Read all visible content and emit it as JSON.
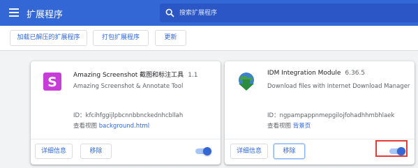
{
  "header": {
    "title": "扩展程序",
    "search_placeholder": "搜索扩展程序",
    "menu_icon": "hamburger-menu-icon",
    "search_icon": "search-icon"
  },
  "toolbar": {
    "load_unpacked": "加载已解压的扩展程序",
    "pack_extension": "打包扩展程序",
    "update": "更新"
  },
  "extensions": [
    {
      "name": "Amazing Screenshot 截图和标注工具",
      "version": "1.1",
      "description": "Amazing Screenshot & Annotate Tool",
      "id_label": "ID：kfcihfggijlpbcnnbbnckednhcbllah",
      "views_label": "查看视图",
      "views_link": "background.html",
      "details_button": "详细信息",
      "remove_button": "移除",
      "enabled": true,
      "icon": "amazing-screenshot-logo-icon",
      "icon_color": "#c83dd8"
    },
    {
      "name": "IDM Integration Module",
      "version": "6.36.5",
      "description": "Download files with Internet Download Manager",
      "id_label": "ID：ngpampappnmepgilojfohadhhmbhlaek",
      "views_label": "查看视图",
      "views_link": "背景页",
      "details_button": "详细信息",
      "remove_button": "移除",
      "enabled": true,
      "icon": "idm-globe-logo-icon",
      "icon_color": "#2a8c3c"
    }
  ],
  "colors": {
    "header_bg": "#3367d6",
    "accent": "#3367d6",
    "highlight_box": "#e53935"
  }
}
